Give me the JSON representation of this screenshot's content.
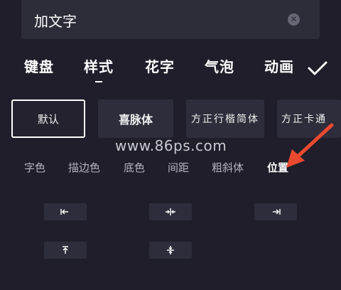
{
  "input": {
    "value": "加文字"
  },
  "tabs": [
    {
      "label": "键盘"
    },
    {
      "label": "样式"
    },
    {
      "label": "花字"
    },
    {
      "label": "气泡"
    },
    {
      "label": "动画"
    }
  ],
  "fonts": [
    {
      "label": "默认"
    },
    {
      "label": "喜脉体"
    },
    {
      "label": "方正行楷简体"
    },
    {
      "label": "方正卡通"
    }
  ],
  "watermark": "www.86ps.com",
  "sub_tabs": [
    {
      "label": "字色"
    },
    {
      "label": "描边色"
    },
    {
      "label": "底色"
    },
    {
      "label": "间距"
    },
    {
      "label": "粗斜体"
    },
    {
      "label": "位置"
    }
  ],
  "position_buttons": [
    "align-left-icon",
    "align-center-horizontal-icon",
    "align-right-icon",
    "align-top-icon",
    "align-center-vertical-icon"
  ],
  "colors": {
    "background": "#1f1e2a",
    "panel": "#2e2d3b",
    "arrow": "#e94a2f"
  }
}
